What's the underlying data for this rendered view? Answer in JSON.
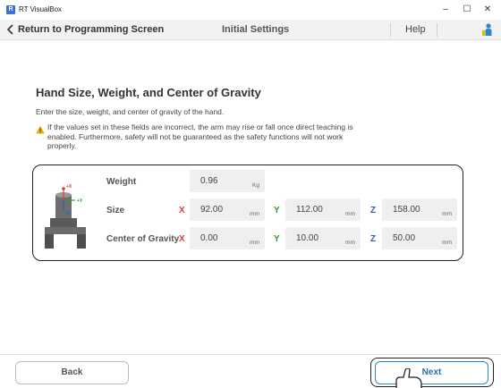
{
  "window": {
    "title": "RT VisualBox",
    "app_icon_text": "R",
    "minimize_glyph": "–",
    "maximize_glyph": "☐",
    "close_glyph": "✕"
  },
  "header": {
    "back_label": "Return to Programming Screen",
    "title": "Initial Settings",
    "help_label": "Help",
    "icons": [
      "chevron-left-icon",
      "user-icon"
    ]
  },
  "section": {
    "title": "Hand Size, Weight, and Center of Gravity",
    "description": "Enter the size, weight, and center of gravity of the hand.",
    "warning": "If the values set in these fields are incorrect, the arm may rise or fall once direct teaching is enabled. Furthermore, safety will not be guaranteed as the safety functions will not work properly."
  },
  "illustration": {
    "axis_x": "+X",
    "axis_y": "+Y",
    "axis_z": "+Z"
  },
  "form": {
    "weight": {
      "label": "Weight",
      "value": "0.96",
      "unit": "Kg"
    },
    "size": {
      "label": "Size",
      "x": {
        "axis": "X",
        "value": "92.00",
        "unit": "mm"
      },
      "y": {
        "axis": "Y",
        "value": "112.00",
        "unit": "mm"
      },
      "z": {
        "axis": "Z",
        "value": "158.00",
        "unit": "mm"
      }
    },
    "cog": {
      "label": "Center of Gravity",
      "x": {
        "axis": "X",
        "value": "0.00",
        "unit": "mm"
      },
      "y": {
        "axis": "Y",
        "value": "10.00",
        "unit": "mm"
      },
      "z": {
        "axis": "Z",
        "value": "50.00",
        "unit": "mm"
      }
    }
  },
  "footer": {
    "back_label": "Back",
    "next_label": "Next"
  },
  "colors": {
    "axis_x": "#e23b3b",
    "axis_y": "#2e9e2e",
    "axis_z": "#2f5cc5",
    "next_border": "#2a88c8",
    "warning": "#f0b400"
  }
}
